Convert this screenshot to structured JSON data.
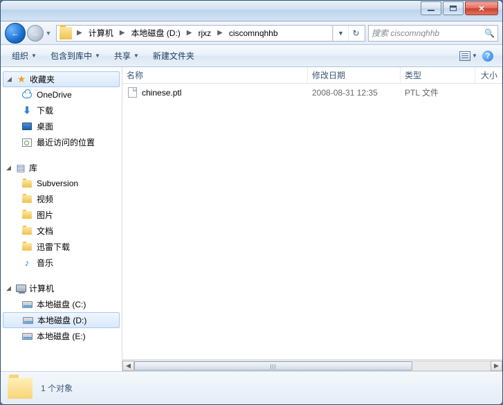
{
  "titlebar": {
    "minimize": "minimize",
    "maximize": "maximize",
    "close": "close"
  },
  "nav": {
    "back": "back",
    "forward": "forward",
    "breadcrumb": [
      "计算机",
      "本地磁盘 (D:)",
      "rjxz",
      "ciscomnqhhb"
    ],
    "search_placeholder": "搜索 ciscomnqhhb"
  },
  "toolbar": {
    "organize": "组织",
    "include": "包含到库中",
    "share": "共享",
    "newfolder": "新建文件夹"
  },
  "sidebar": {
    "favorites": {
      "label": "收藏夹",
      "items": [
        "OneDrive",
        "下载",
        "桌面",
        "最近访问的位置"
      ]
    },
    "libraries": {
      "label": "库",
      "items": [
        "Subversion",
        "视频",
        "图片",
        "文档",
        "迅雷下载",
        "音乐"
      ]
    },
    "computer": {
      "label": "计算机",
      "items": [
        "本地磁盘 (C:)",
        "本地磁盘 (D:)",
        "本地磁盘 (E:)"
      ]
    }
  },
  "columns": {
    "name": "名称",
    "date": "修改日期",
    "type": "类型",
    "size": "大小"
  },
  "files": [
    {
      "name": "chinese.ptl",
      "date": "2008-08-31 12:35",
      "type": "PTL 文件",
      "size": ""
    }
  ],
  "status": {
    "text": "1 个对象"
  }
}
